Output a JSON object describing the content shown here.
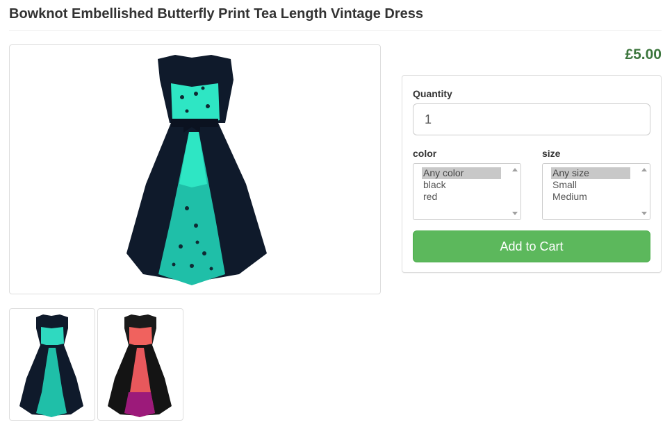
{
  "product": {
    "title": "Bowknot Embellished Butterfly Print Tea Length Vintage Dress",
    "price": "£5.00",
    "main_image": {
      "icon": "dress-image",
      "colors": {
        "body": "#0f1a2b",
        "accent": "#2ee6c4"
      }
    },
    "thumbnails": [
      {
        "icon": "dress-thumbnail-teal",
        "accent": "#2fd9c0"
      },
      {
        "icon": "dress-thumbnail-red",
        "accent": "#f0625e",
        "accent_low": "#9c1a7a"
      }
    ]
  },
  "form": {
    "quantity_label": "Quantity",
    "quantity_value": "1",
    "color_label": "color",
    "color_options": [
      "Any color",
      "black",
      "red"
    ],
    "color_selected": "Any color",
    "size_label": "size",
    "size_options": [
      "Any size",
      "Small",
      "Medium"
    ],
    "size_selected": "Any size",
    "add_to_cart_label": "Add to Cart"
  },
  "colors": {
    "price": "#3c763d",
    "button": "#5cb85c",
    "border": "#dddddd"
  }
}
